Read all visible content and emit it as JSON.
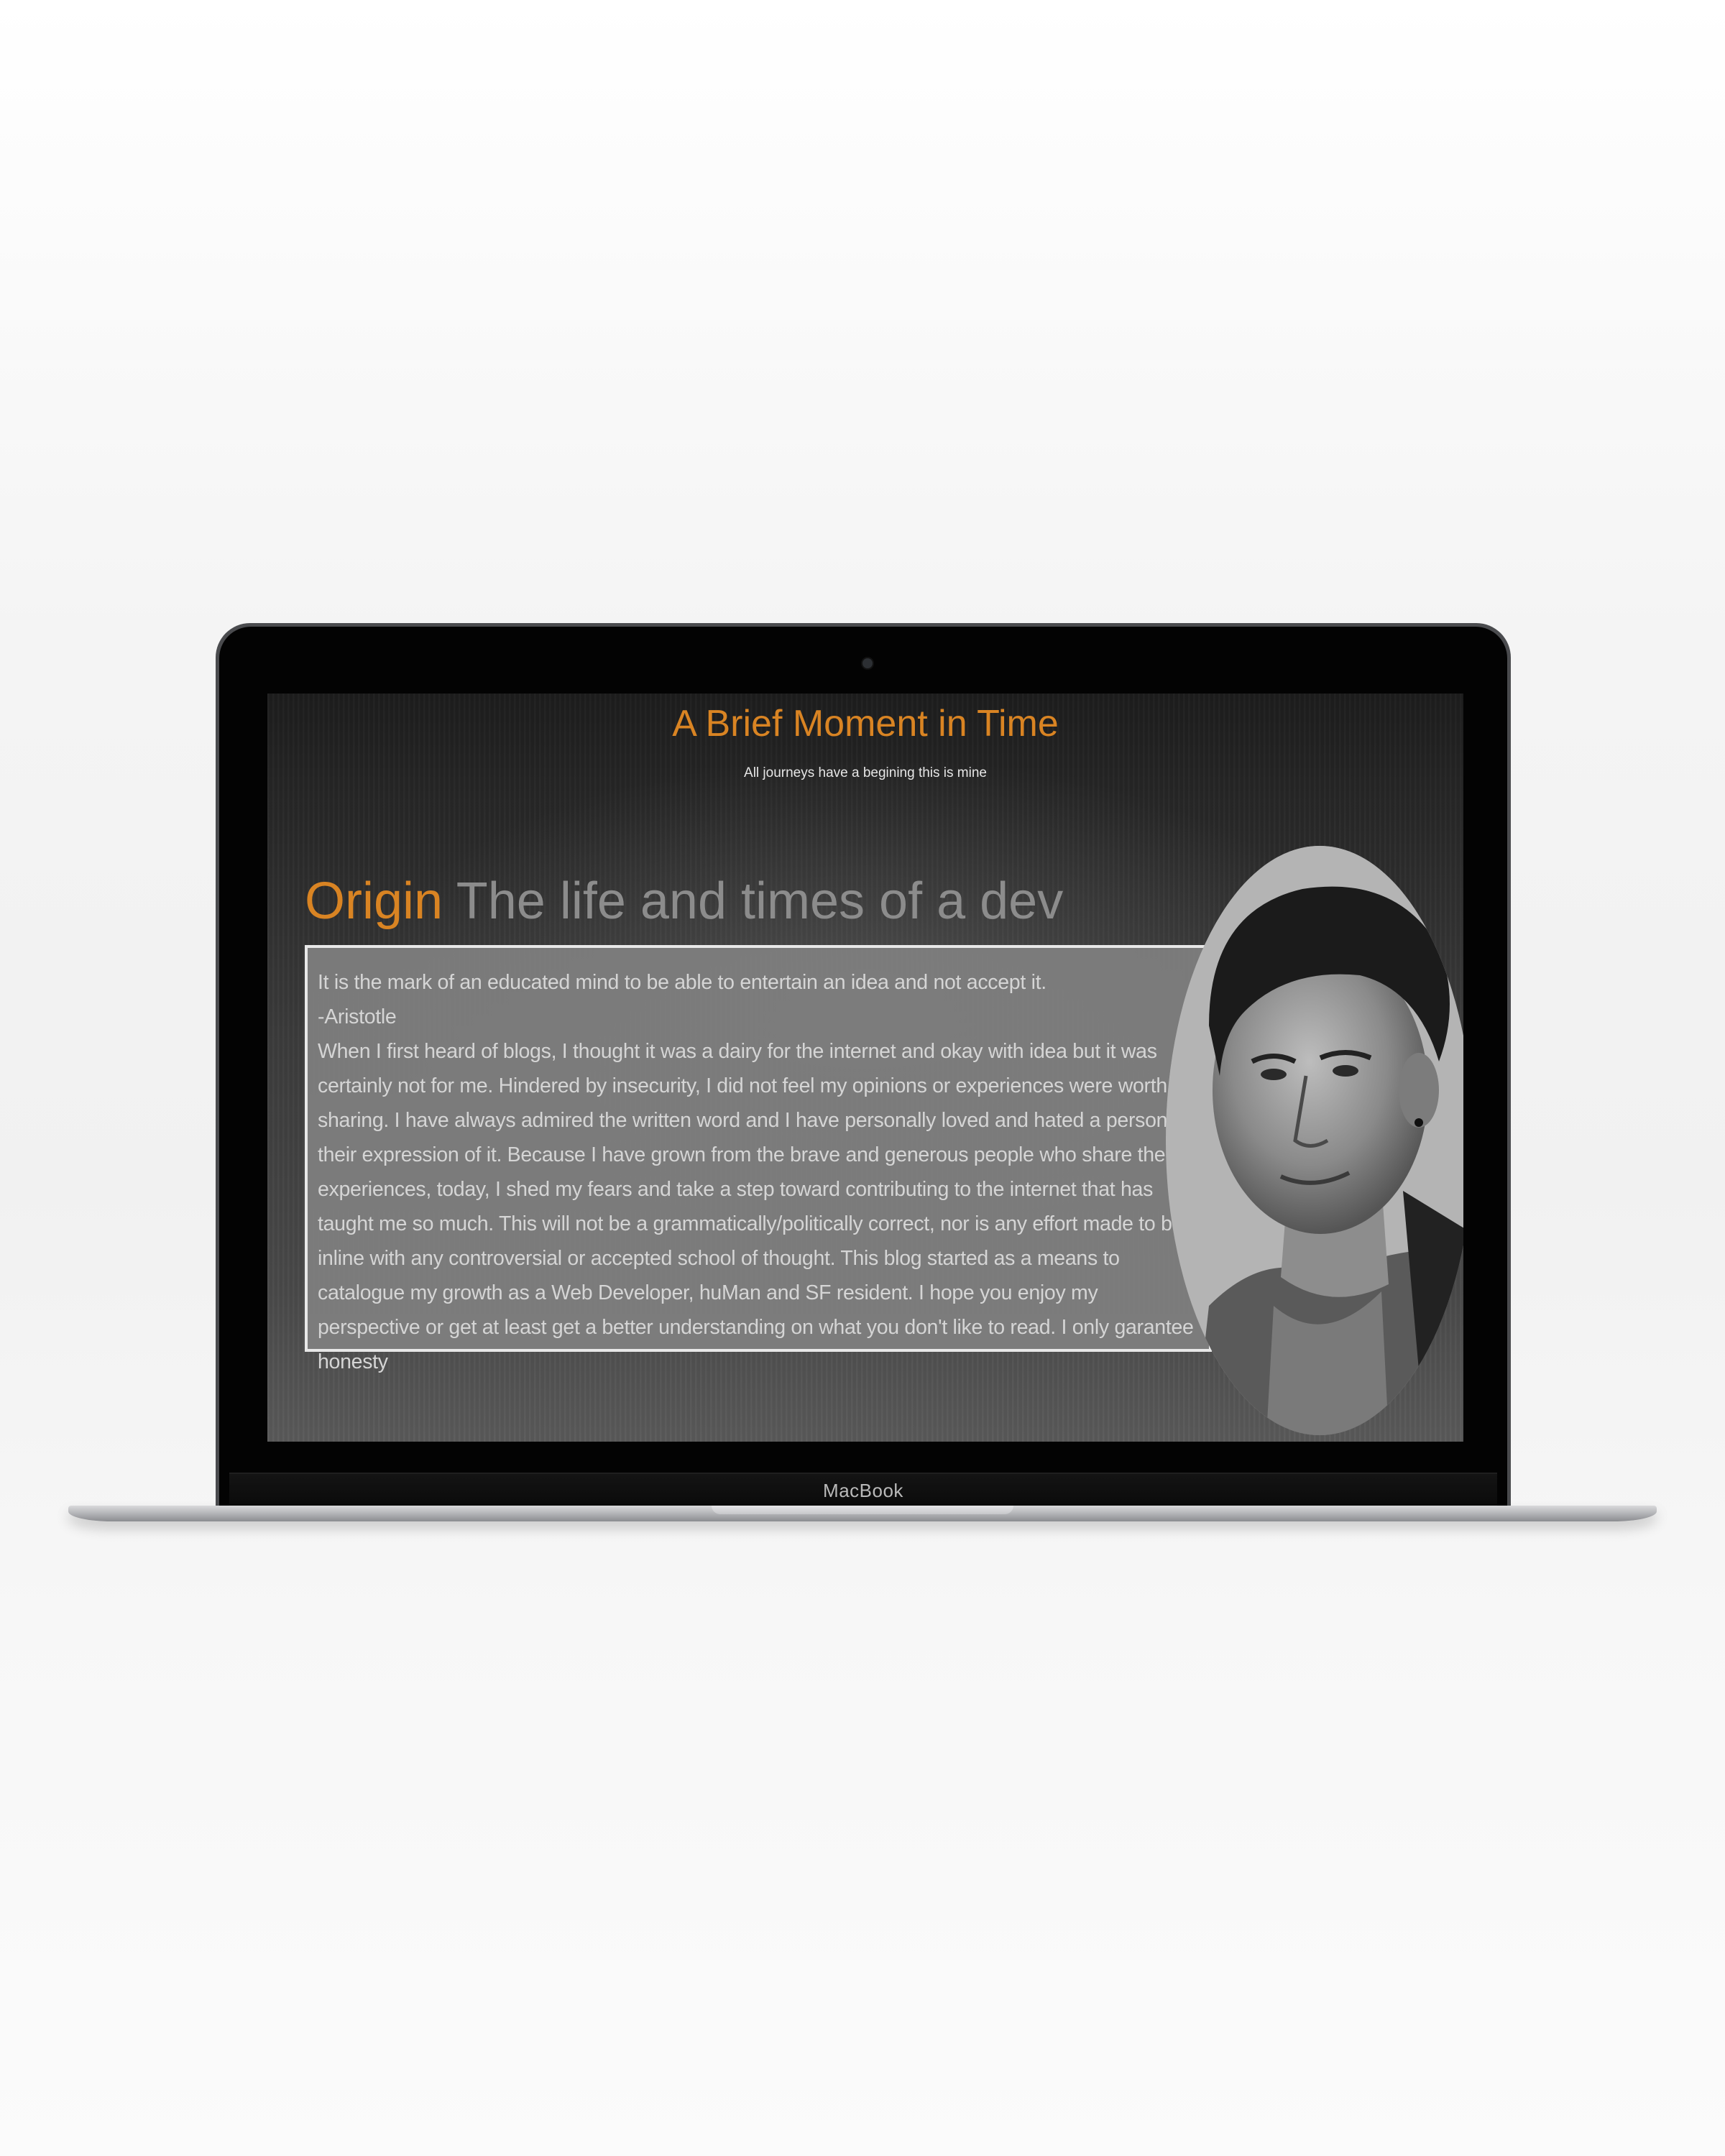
{
  "device": {
    "brand_label": "MacBook"
  },
  "site": {
    "title": "A Brief Moment in Time",
    "tagline": "All journeys have a begining this is mine"
  },
  "post": {
    "heading_accent": "Origin",
    "heading_rest": " The life and times of a dev",
    "quote": "It is the mark of an educated mind to be able to entertain an idea and not accept it.",
    "quote_author": "-Aristotle",
    "body": "When I first heard of blogs, I thought it was a dairy for the internet and okay with idea but it was certainly not for me. Hindered by insecurity, I did not feel my opinions or experiences were worth sharing. I have always admired the written word and I have personally loved and hated a person for their expression of it. Because I have grown from the brave and generous people who share their experiences, today, I shed my fears and take a step toward contributing to the internet that has taught me so much. This will not be a grammatically/politically correct, nor is any effort made to be inline with any controversial or accepted school of thought. This blog started as a means to catalogue my growth as a Web Developer, huMan and SF resident. I hope you enjoy my perspective or get at least get a better understanding on what you don't like to read. I only garantee honesty"
  },
  "colors": {
    "accent": "#d98423",
    "heading_muted": "#8c8c8c",
    "post_background": "#808080",
    "post_text": "#d5d5d5"
  }
}
